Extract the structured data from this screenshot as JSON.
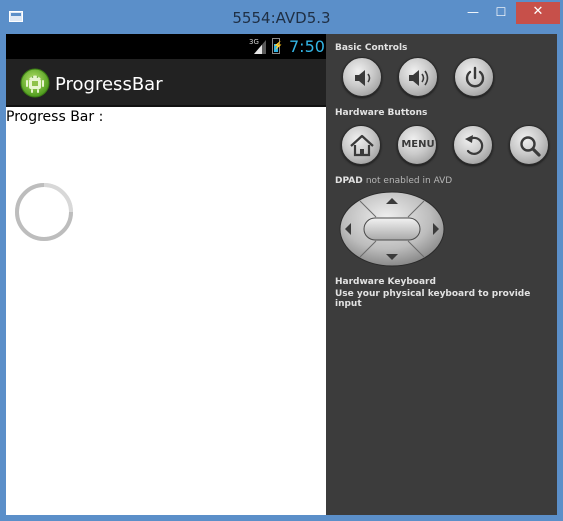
{
  "window": {
    "title": "5554:AVD5.3",
    "minimize_glyph": "—",
    "maximize_glyph": "☐",
    "close_glyph": "✕"
  },
  "status_bar": {
    "network_type": "3G",
    "time": "7:50",
    "battery_color": "#33b5e5"
  },
  "app": {
    "title": "ProgressBar",
    "icon": "android-app-icon"
  },
  "content": {
    "progress_label": "Progress Bar :",
    "progress_type": "indeterminate-spinner"
  },
  "controls": {
    "basic_controls_label": "Basic Controls",
    "basic_buttons": [
      "volume-down-icon",
      "volume-up-icon",
      "power-icon"
    ],
    "hardware_buttons_label": "Hardware Buttons",
    "hardware_buttons": [
      "home-icon",
      "menu-button",
      "back-icon",
      "search-icon"
    ],
    "menu_label": "MENU",
    "dpad_label": "DPAD",
    "dpad_note": "not enabled in AVD",
    "keyboard_title": "Hardware Keyboard",
    "keyboard_desc": "Use your physical keyboard to provide input"
  },
  "colors": {
    "window_frame": "#5b8fc9",
    "close_button": "#c7504a",
    "action_bar": "#222222",
    "controls_panel": "#3c3c3c",
    "holo_blue": "#33b5e5"
  }
}
